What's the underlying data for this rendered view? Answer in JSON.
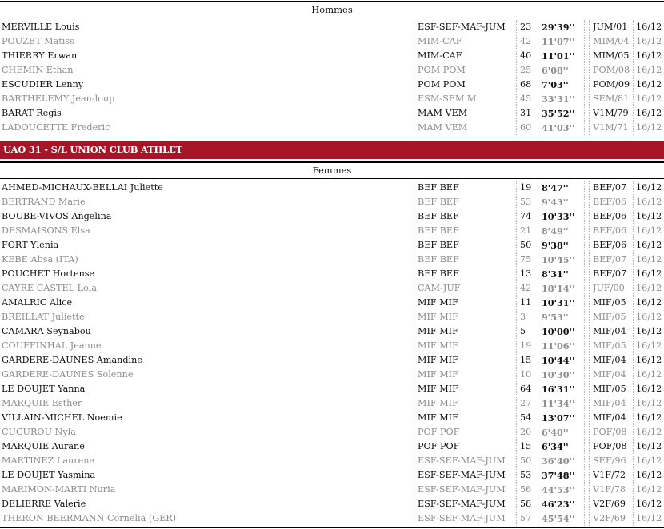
{
  "sections": [
    {
      "header": "Hommes",
      "rows": [
        {
          "name": "MERVILLE Louis",
          "cat": "ESF-SEF-MAF-JUM",
          "num": "23",
          "time": "29'39''",
          "rank": "JUM/01",
          "date": "16/12"
        },
        {
          "name": "POUZET Matiss",
          "cat": "MIM-CAF",
          "num": "42",
          "time": "11'07''",
          "rank": "MIM/04",
          "date": "16/12"
        },
        {
          "name": "THIERRY Erwan",
          "cat": "MIM-CAF",
          "num": "40",
          "time": "11'01''",
          "rank": "MIM/05",
          "date": "16/12"
        },
        {
          "name": "CHEMIN Ethan",
          "cat": "POM POM",
          "num": "25",
          "time": "6'08''",
          "rank": "POM/08",
          "date": "16/12"
        },
        {
          "name": "ESCUDIER Lenny",
          "cat": "POM POM",
          "num": "68",
          "time": "7'03''",
          "rank": "POM/09",
          "date": "16/12"
        },
        {
          "name": "BARTHELEMY Jean-loup",
          "cat": "ESM-SEM M",
          "num": "45",
          "time": "33'31''",
          "rank": "SEM/81",
          "date": "16/12"
        },
        {
          "name": "BARAT Regis",
          "cat": "MAM VEM",
          "num": "31",
          "time": "35'52''",
          "rank": "V1M/79",
          "date": "16/12"
        },
        {
          "name": "LADOUCETTE Frederic",
          "cat": "MAM VEM",
          "num": "60",
          "time": "41'03''",
          "rank": "V1M/71",
          "date": "16/12"
        }
      ]
    },
    {
      "club": "UAO 31 - S/L UNION CLUB ATHLET",
      "header": "Femmes",
      "rows": [
        {
          "name": "AHMED-MICHAUX-BELLAI Juliette",
          "cat": "BEF BEF",
          "num": "19",
          "time": "8'47''",
          "rank": "BEF/07",
          "date": "16/12"
        },
        {
          "name": "BERTRAND Marie",
          "cat": "BEF BEF",
          "num": "53",
          "time": "9'43''",
          "rank": "BEF/06",
          "date": "16/12"
        },
        {
          "name": "BOUBE-VIVOS Angelina",
          "cat": "BEF BEF",
          "num": "74",
          "time": "10'33''",
          "rank": "BEF/06",
          "date": "16/12"
        },
        {
          "name": "DESMAISONS Elsa",
          "cat": "BEF BEF",
          "num": "21",
          "time": "8'49''",
          "rank": "BEF/06",
          "date": "16/12"
        },
        {
          "name": "FORT Ylenia",
          "cat": "BEF BEF",
          "num": "50",
          "time": "9'38''",
          "rank": "BEF/06",
          "date": "16/12"
        },
        {
          "name": "KEBE Absa (ITA)",
          "cat": "BEF BEF",
          "num": "75",
          "time": "10'45''",
          "rank": "BEF/07",
          "date": "16/12"
        },
        {
          "name": "POUCHET Hortense",
          "cat": "BEF BEF",
          "num": "13",
          "time": "8'31''",
          "rank": "BEF/07",
          "date": "16/12"
        },
        {
          "name": "CAYRE CASTEL Lola",
          "cat": "CAM-JUF",
          "num": "42",
          "time": "18'14''",
          "rank": "JUF/00",
          "date": "16/12"
        },
        {
          "name": "AMALRIC Alice",
          "cat": "MIF MIF",
          "num": "11",
          "time": "10'31''",
          "rank": "MIF/05",
          "date": "16/12"
        },
        {
          "name": "BREILLAT Juliette",
          "cat": "MIF MIF",
          "num": "3",
          "time": "9'53''",
          "rank": "MIF/05",
          "date": "16/12"
        },
        {
          "name": "CAMARA Seynabou",
          "cat": "MIF MIF",
          "num": "5",
          "time": "10'00''",
          "rank": "MIF/04",
          "date": "16/12"
        },
        {
          "name": "COUFFINHAL Jeanne",
          "cat": "MIF MIF",
          "num": "19",
          "time": "11'06''",
          "rank": "MIF/05",
          "date": "16/12"
        },
        {
          "name": "GARDERE-DAUNES Amandine",
          "cat": "MIF MIF",
          "num": "15",
          "time": "10'44''",
          "rank": "MIF/04",
          "date": "16/12"
        },
        {
          "name": "GARDERE-DAUNES Solenne",
          "cat": "MIF MIF",
          "num": "10",
          "time": "10'30''",
          "rank": "MIF/04",
          "date": "16/12"
        },
        {
          "name": "LE DOUJET Yanna",
          "cat": "MIF MIF",
          "num": "64",
          "time": "16'31''",
          "rank": "MIF/05",
          "date": "16/12"
        },
        {
          "name": "MARQUIE Esther",
          "cat": "MIF MIF",
          "num": "27",
          "time": "11'34''",
          "rank": "MIF/04",
          "date": "16/12"
        },
        {
          "name": "VILLAIN-MICHEL Noemie",
          "cat": "MIF MIF",
          "num": "54",
          "time": "13'07''",
          "rank": "MIF/04",
          "date": "16/12"
        },
        {
          "name": "CUCUROU Nyla",
          "cat": "POF POF",
          "num": "20",
          "time": "6'40''",
          "rank": "POF/08",
          "date": "16/12"
        },
        {
          "name": "MARQUIE Aurane",
          "cat": "POF POF",
          "num": "15",
          "time": "6'34''",
          "rank": "POF/08",
          "date": "16/12"
        },
        {
          "name": "MARTINEZ Laurene",
          "cat": "ESF-SEF-MAF-JUM",
          "num": "50",
          "time": "36'40''",
          "rank": "SEF/96",
          "date": "16/12"
        },
        {
          "name": "LE DOUJET Yasmina",
          "cat": "ESF-SEF-MAF-JUM",
          "num": "53",
          "time": "37'48''",
          "rank": "V1F/72",
          "date": "16/12"
        },
        {
          "name": "MARIMON-MARTI Nuria",
          "cat": "ESF-SEF-MAF-JUM",
          "num": "56",
          "time": "44'53''",
          "rank": "V1F/78",
          "date": "16/12"
        },
        {
          "name": "DELIERRE Valerie",
          "cat": "ESF-SEF-MAF-JUM",
          "num": "58",
          "time": "46'23''",
          "rank": "V2F/69",
          "date": "16/12"
        },
        {
          "name": "THERON BEERMANN Cornelia (GER)",
          "cat": "ESF-SEF-MAF-JUM",
          "num": "57",
          "time": "45'54''",
          "rank": "V2F/69",
          "date": "16/12"
        }
      ]
    }
  ],
  "colors": {
    "club_bar": "#a51528",
    "alt_text": "#8d8d8d",
    "text": "#111111"
  }
}
